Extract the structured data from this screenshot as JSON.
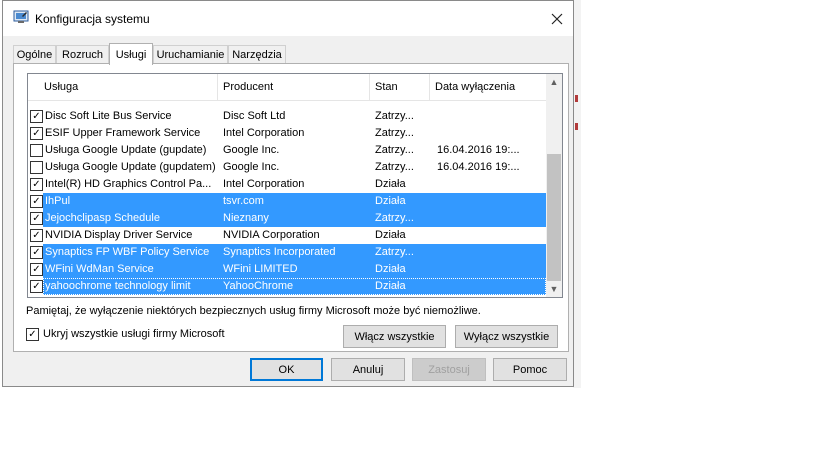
{
  "window": {
    "title": "Konfiguracja systemu",
    "tabs": [
      {
        "label": "Ogólne"
      },
      {
        "label": "Rozruch"
      },
      {
        "label": "Usługi"
      },
      {
        "label": "Uruchamianie"
      },
      {
        "label": "Narzędzia"
      }
    ],
    "active_tab": "Usługi"
  },
  "services": {
    "columns": [
      "Usługa",
      "Producent",
      "Stan",
      "Data wyłączenia"
    ],
    "rows": [
      {
        "checked": true,
        "name": "Disc Soft Lite Bus Service",
        "vendor": "Disc Soft Ltd",
        "state": "Zatrzy...",
        "date": "",
        "selected": false
      },
      {
        "checked": true,
        "name": "ESIF Upper Framework Service",
        "vendor": "Intel Corporation",
        "state": "Zatrzy...",
        "date": "",
        "selected": false
      },
      {
        "checked": false,
        "name": "Usługa Google Update (gupdate)",
        "vendor": "Google Inc.",
        "state": "Zatrzy...",
        "date": "16.04.2016 19:...",
        "selected": false
      },
      {
        "checked": false,
        "name": "Usługa Google Update (gupdatem)",
        "vendor": "Google Inc.",
        "state": "Zatrzy...",
        "date": "16.04.2016 19:...",
        "selected": false
      },
      {
        "checked": true,
        "name": "Intel(R) HD Graphics Control Pa...",
        "vendor": "Intel Corporation",
        "state": "Działa",
        "date": "",
        "selected": false
      },
      {
        "checked": true,
        "name": "IhPul",
        "vendor": "tsvr.com",
        "state": "Działa",
        "date": "",
        "selected": true
      },
      {
        "checked": true,
        "name": "Jejochclipasp Schedule",
        "vendor": "Nieznany",
        "state": "Zatrzy...",
        "date": "",
        "selected": true
      },
      {
        "checked": true,
        "name": "NVIDIA Display Driver Service",
        "vendor": "NVIDIA Corporation",
        "state": "Działa",
        "date": "",
        "selected": false
      },
      {
        "checked": true,
        "name": "Synaptics FP WBF Policy Service",
        "vendor": "Synaptics Incorporated",
        "state": "Zatrzy...",
        "date": "",
        "selected": true
      },
      {
        "checked": true,
        "name": "WFini WdMan Service",
        "vendor": "WFini LIMITED",
        "state": "Działa",
        "date": "",
        "selected": true
      },
      {
        "checked": true,
        "name": "yahoochrome technology limit",
        "vendor": "YahooChrome",
        "state": "Działa",
        "date": "",
        "selected": true,
        "focused": true
      }
    ]
  },
  "note": "Pamiętaj, że wyłączenie niektórych bezpiecznych usług firmy Microsoft może być niemożliwe.",
  "hide_ms": {
    "label": "Ukryj wszystkie usługi firmy Microsoft",
    "checked": true
  },
  "buttons": {
    "enable_all": "Włącz wszystkie",
    "disable_all": "Wyłącz wszystkie",
    "ok": "OK",
    "cancel": "Anuluj",
    "apply": "Zastosuj",
    "help": "Pomoc"
  },
  "colors": {
    "selection": "#3399ff",
    "default_button_border": "#0078d7"
  },
  "icons": {
    "app": "msconfig-icon",
    "close": "close-icon",
    "scroll_up": "scroll-up-arrow-icon",
    "scroll_down": "scroll-down-arrow-icon",
    "check": "checkmark-icon"
  }
}
